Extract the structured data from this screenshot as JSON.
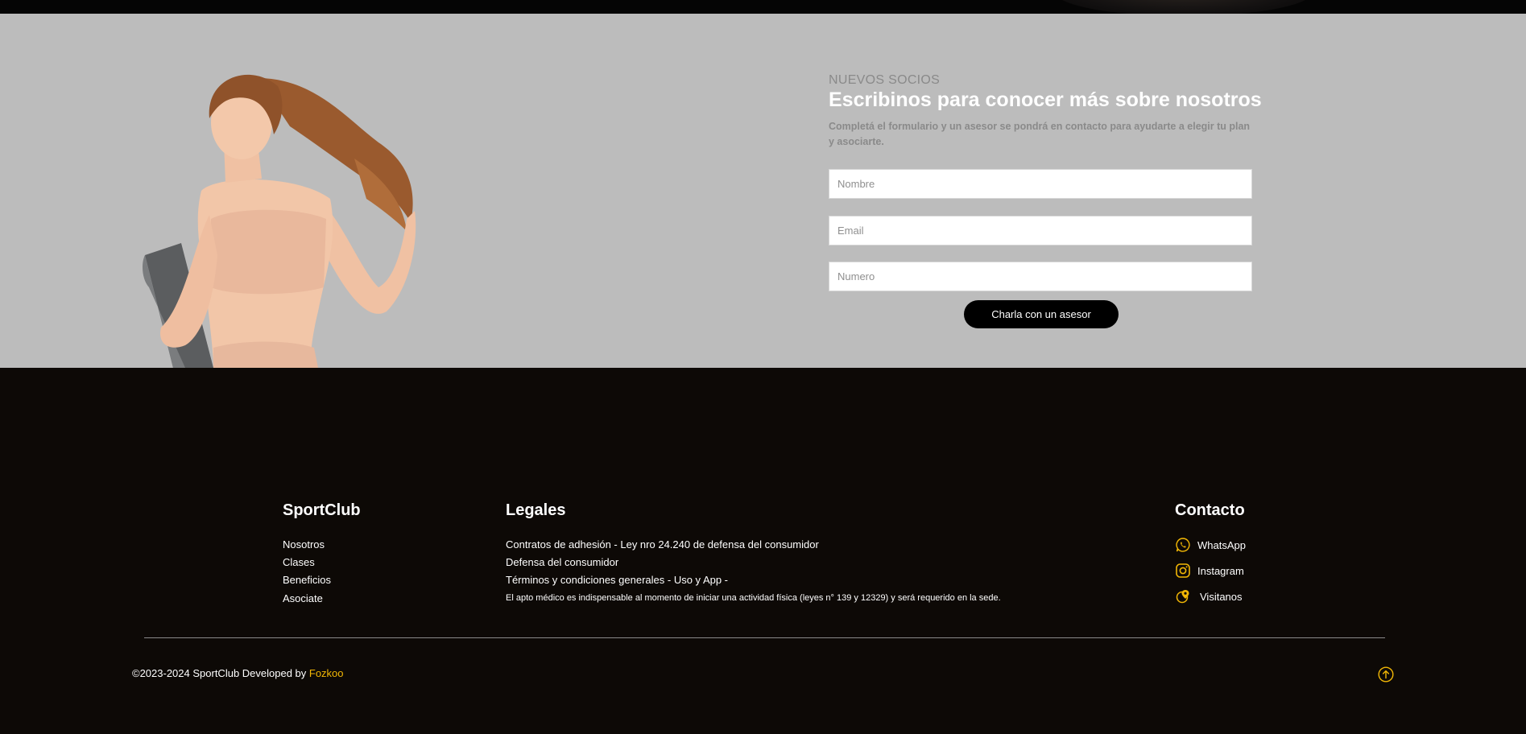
{
  "signup": {
    "eyebrow": "NUEVOS SOCIOS",
    "headline": "Escribinos para conocer más sobre nosotros",
    "subtext": "Completá el formulario y un asesor se pondrá en contacto para ayudarte a elegir tu plan y asociarte.",
    "fields": {
      "name_placeholder": "Nombre",
      "email_placeholder": "Email",
      "phone_placeholder": "Numero"
    },
    "cta_label": "Charla con un asesor"
  },
  "footer": {
    "brand": {
      "title": "SportClub",
      "links": [
        "Nosotros",
        "Clases",
        "Beneficios",
        "Asociate"
      ]
    },
    "legal": {
      "title": "Legales",
      "links": [
        "Contratos de adhesión - Ley nro 24.240 de defensa del consumidor",
        "Defensa del consumidor",
        "Términos y condiciones generales - Uso y App -"
      ],
      "note": "El apto médico es indispensable al momento de iniciar una actividad física (leyes n° 139 y 12329) y será requerido en la sede."
    },
    "contact": {
      "title": "Contacto",
      "items": [
        {
          "label": "WhatsApp",
          "icon": "whatsapp-icon"
        },
        {
          "label": "Instagram",
          "icon": "instagram-icon"
        },
        {
          "label": "Visitanos",
          "icon": "location-icon"
        }
      ]
    },
    "copyright_prefix": "©2023-2024 SportClub Developed by ",
    "developer": "Fozkoo",
    "accent_color": "#f2b705"
  }
}
